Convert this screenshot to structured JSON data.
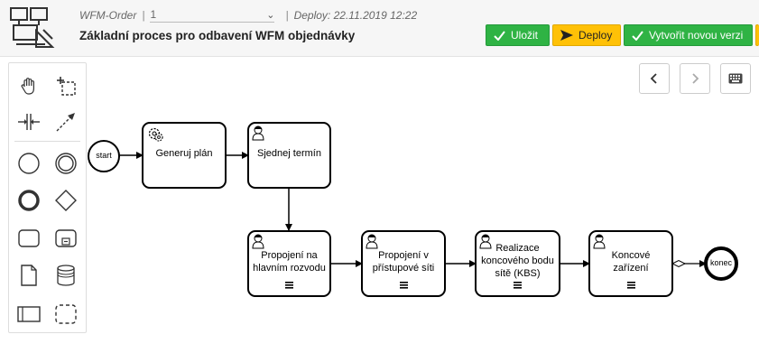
{
  "header": {
    "app_name": "WFM-Order",
    "version": "1",
    "deploy_text": "Deploy: 22.11.2019 12:22",
    "process_title": "Základní proces pro odbavení WFM objednávky",
    "buttons": {
      "save_label": "Uložit",
      "deploy_label": "Deploy",
      "new_version_label": "Vytvořit novou verzi"
    }
  },
  "palette": {
    "tools": [
      "hand-tool",
      "lasso-tool",
      "space-tool",
      "connect-tool",
      "start-event",
      "intermediate-event",
      "end-event",
      "gateway",
      "task",
      "subprocess",
      "data-object",
      "data-store",
      "pool",
      "group"
    ]
  },
  "diagram": {
    "start_label": "start",
    "end_label": "konec",
    "tasks": [
      {
        "label": "Generuj plán",
        "type": "service"
      },
      {
        "label": "Sjednej termín",
        "type": "user"
      },
      {
        "label": "Propojení na hlavním rozvodu",
        "type": "user"
      },
      {
        "label": "Propojení v přístupové síti",
        "type": "user"
      },
      {
        "label": "Realizace koncového bodu sítě (KBS)",
        "type": "user"
      },
      {
        "label": "Koncové zařízení",
        "type": "user"
      }
    ]
  },
  "colors": {
    "green": "#2fb344",
    "yellow": "#ffc107"
  }
}
